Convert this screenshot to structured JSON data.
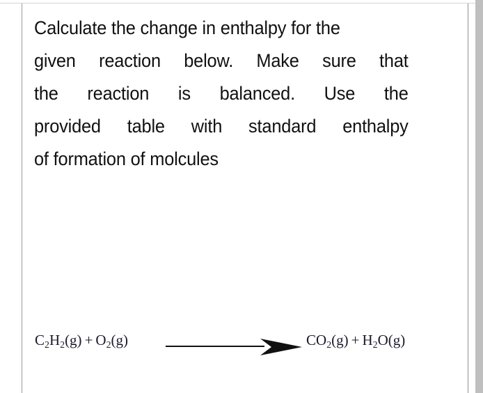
{
  "page": {
    "background_color": "#ffffff",
    "text_color": "#111111",
    "rule_color": "#9a9a9a",
    "scrollbar_color": "#bfbfbf"
  },
  "prompt": {
    "full_text": "Calculate the change in enthalpy for the given reaction below. Make sure that the reaction is balanced. Use the provided table with standard enthalpy of formation of molcules",
    "lines": [
      "Calculate the change in enthalpy for the",
      "given reaction below. Make sure that",
      "the reaction is balanced. Use the",
      "provided table with standard enthalpy",
      "of formation of molcules"
    ],
    "line2_words": [
      "given",
      "reaction",
      "below.",
      "Make",
      "sure",
      "that"
    ],
    "line3_words": [
      "the",
      "reaction",
      "is",
      "balanced.",
      "Use",
      "the"
    ],
    "line4_words": [
      "provided",
      "table",
      "with",
      "standard",
      "enthalpy"
    ]
  },
  "equation": {
    "reactants": {
      "species": [
        {
          "formula": "C2H2",
          "state": "(g)"
        },
        {
          "formula": "O2",
          "state": "(g)"
        }
      ],
      "plus": "+",
      "text": "C2H2(g) + O2(g)"
    },
    "arrow": {
      "type": "reaction-arrow",
      "direction": "right",
      "label": ""
    },
    "products": {
      "species": [
        {
          "formula": "CO2",
          "state": "(g)"
        },
        {
          "formula": "H2O",
          "state": "(g)"
        }
      ],
      "plus": "+",
      "text": "CO2(g) + H2O(g)"
    },
    "parts": {
      "c2h2_c": "C",
      "c2h2_sub1": "2",
      "c2h2_h": "H",
      "c2h2_sub2": "2",
      "c2h2_state": "(g)",
      "o2_o": "O",
      "o2_sub": "2",
      "o2_state": "(g)",
      "co2_co": "CO",
      "co2_sub": "2",
      "co2_state": "(g)",
      "h2o_h": "H",
      "h2o_sub": "2",
      "h2o_o": "O",
      "h2o_state": "(g)",
      "plus": "+"
    }
  }
}
